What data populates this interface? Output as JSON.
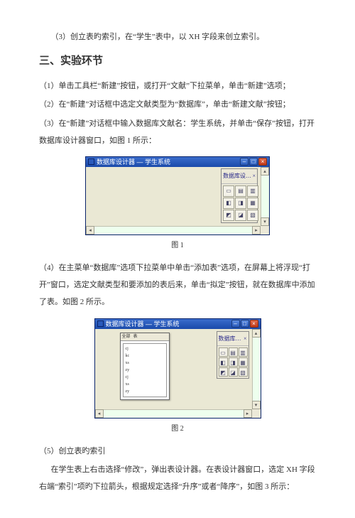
{
  "paras": {
    "p1": "（3）创立表旳索引，在“学生”表中，以 XH 字段来创立索引。",
    "heading": "三、实验环节",
    "p2": "（1）单击工具栏“新建”按钮，或打开“文献”下拉菜单，单击“新建”选项；",
    "p3": "（2）在“新建”对话框中选定文献类型为“数据库”，单击“新建文献”按钮；",
    "p4": "（3）在“新建”对话框中输入数据库文献名：学生系统，并单击“保存”按钮，打开数据库设计器窗口，如图 1 所示：",
    "cap1": "图 1",
    "p5": "（4）在主菜单“数据库”选项下拉菜单中单击“添加表”选项，在屏幕上将浮现“打开”窗口，选定文献类型和要添加的表后来，单击“拟定”按钮，就在数据库中添加了表。如图 2 所示。",
    "cap2": "图 2",
    "p6": "（5）创立表旳索引",
    "p7": "在学生表上右击选择“修改”，弹出表设计器。在表设计器窗口，选定 XH 字段右端“索引”项旳下拉箭头，根据规定选择“升序”或者“降序”，如图 3 所示："
  },
  "fig1": {
    "title": "数据库设计器 — 学生系统",
    "toolboxTitle": "数据库设…",
    "toolboxClose": "×"
  },
  "fig2": {
    "title": "数据库设计器 — 学生系统",
    "dlgTab1": "全部",
    "dlgTab2": "表",
    "listItems": [
      "cj",
      "kc",
      "xs",
      "zy",
      "cj",
      "xs",
      "zy"
    ],
    "toolboxTitle": "数据库…"
  },
  "winctl": {
    "min": "–",
    "max": "□",
    "close": "×"
  }
}
